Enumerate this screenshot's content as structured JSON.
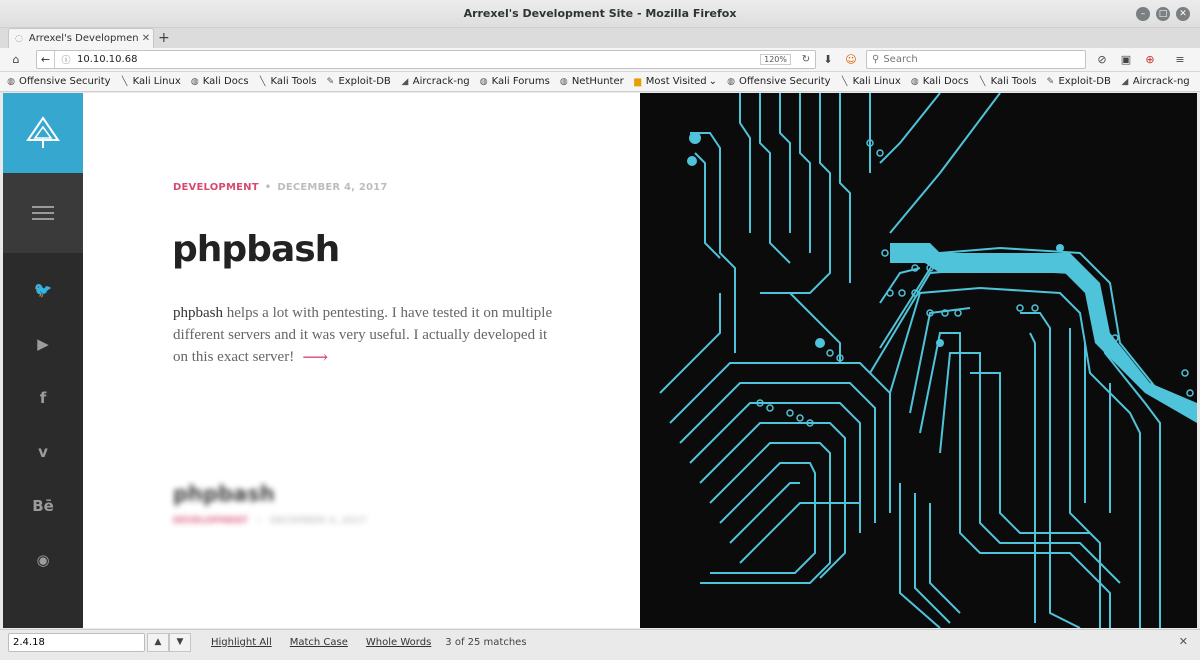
{
  "window": {
    "title": "Arrexel's Development Site - Mozilla Firefox"
  },
  "tab": {
    "title": "Arrexel's Developmen..."
  },
  "navbar": {
    "url": "10.10.10.68",
    "zoom": "120%",
    "search_placeholder": "Search"
  },
  "bookmarks": [
    {
      "label": "Offensive Security",
      "icon": "offsec-icon"
    },
    {
      "label": "Kali Linux",
      "icon": "kali-icon"
    },
    {
      "label": "Kali Docs",
      "icon": "offsec-icon"
    },
    {
      "label": "Kali Tools",
      "icon": "kali-icon"
    },
    {
      "label": "Exploit-DB",
      "icon": "exploitdb-icon"
    },
    {
      "label": "Aircrack-ng",
      "icon": "aircrack-icon"
    },
    {
      "label": "Kali Forums",
      "icon": "offsec-icon"
    },
    {
      "label": "NetHunter",
      "icon": "offsec-icon"
    },
    {
      "label": "Most Visited",
      "icon": "folder-icon"
    },
    {
      "label": "Offensive Security",
      "icon": "offsec-icon"
    },
    {
      "label": "Kali Linux",
      "icon": "kali-icon"
    },
    {
      "label": "Kali Docs",
      "icon": "offsec-icon"
    },
    {
      "label": "Kali Tools",
      "icon": "kali-icon"
    },
    {
      "label": "Exploit-DB",
      "icon": "exploitdb-icon"
    },
    {
      "label": "Aircrack-ng",
      "icon": "aircrack-icon"
    }
  ],
  "sidebar": {
    "social": [
      {
        "name": "twitter-icon",
        "glyph": "🐦"
      },
      {
        "name": "youtube-icon",
        "glyph": "▶"
      },
      {
        "name": "facebook-icon",
        "glyph": "f"
      },
      {
        "name": "vimeo-icon",
        "glyph": "v"
      },
      {
        "name": "behance-icon",
        "glyph": "Bē"
      },
      {
        "name": "rss-icon",
        "glyph": "◉"
      }
    ],
    "accent": "#36a7cf"
  },
  "post": {
    "category": "DEVELOPMENT",
    "date": "DECEMBER 4, 2017",
    "title": "phpbash",
    "excerpt_lead": "phpbash",
    "excerpt_rest": " helps a lot with pentesting. I have tested it on multiple different servers and it was very useful. I actually developed it on this exact server!"
  },
  "post2": {
    "title": "phpbash",
    "category": "DEVELOPMENT",
    "date": "DECEMBER 4, 2017"
  },
  "findbar": {
    "query": "2.4.18",
    "highlight_all": "Highlight All",
    "match_case": "Match Case",
    "whole_words": "Whole Words",
    "status": "3 of 25 matches"
  },
  "colors": {
    "accent_pink": "#d74a6f",
    "circuit": "#4fc3d9"
  }
}
